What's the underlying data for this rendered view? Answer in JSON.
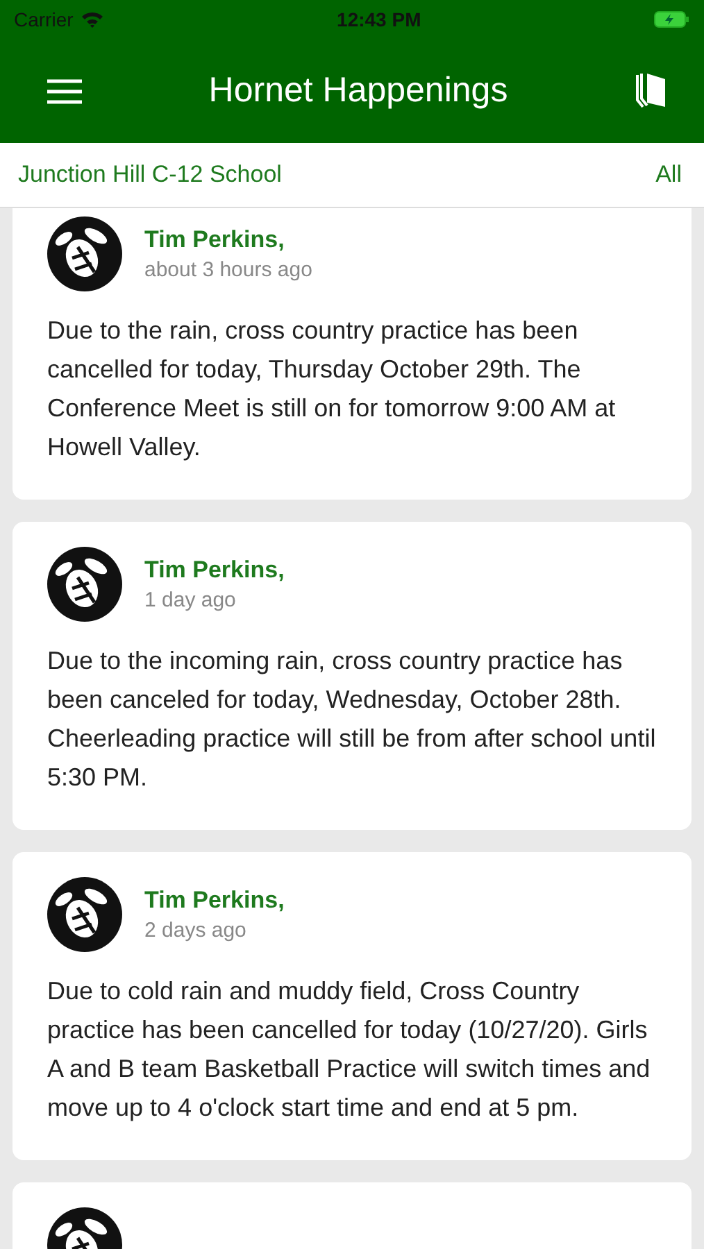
{
  "status_bar": {
    "carrier": "Carrier",
    "time": "12:43 PM"
  },
  "header": {
    "title": "Hornet Happenings"
  },
  "filter_bar": {
    "school": "Junction Hill C-12 School",
    "filter": "All"
  },
  "posts": [
    {
      "author": "Tim Perkins,",
      "time": "about 3 hours ago",
      "body": "Due to the rain, cross country practice has been cancelled for today, Thursday October 29th. The Conference Meet is still on for tomorrow 9:00 AM at Howell Valley."
    },
    {
      "author": "Tim Perkins,",
      "time": "1 day ago",
      "body": "Due to the incoming rain, cross country practice has been canceled for today, Wednesday, October 28th. Cheerleading practice will still be from after school until 5:30 PM."
    },
    {
      "author": "Tim Perkins,",
      "time": "2 days ago",
      "body": "Due to cold rain and muddy field, Cross Country practice has been cancelled for today (10/27/20). Girls A and B team Basketball Practice will switch times and move up to 4 o'clock start time and end at 5 pm."
    }
  ]
}
